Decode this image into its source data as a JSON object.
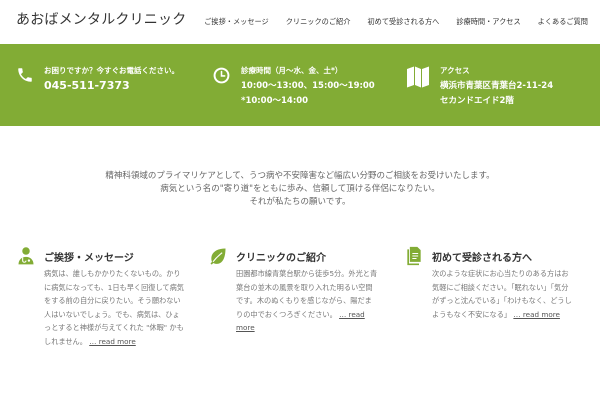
{
  "header": {
    "site_title": "あおばメンタルクリニック",
    "nav": [
      "ご挨拶・メッセージ",
      "クリニックのご紹介",
      "初めて受診される方へ",
      "診療時間・アクセス",
      "よくあるご質問"
    ]
  },
  "info": {
    "phone": {
      "label": "お困りですか？今すぐお電話ください。",
      "value": "045-511-7373",
      "icon": "phone-icon"
    },
    "hours": {
      "label": "診療時間（月〜水、金、土*）",
      "line1": "10:00〜13:00、15:00〜19:00",
      "line2": "*10:00〜14:00",
      "icon": "clock-icon"
    },
    "access": {
      "label": "アクセス",
      "line1": "横浜市青葉区青葉台2-11-24",
      "line2": "セカンドエイド2階",
      "icon": "map-icon"
    },
    "bar_color": "#82ac35"
  },
  "intro": {
    "line1": "精神科領域のプライマリケアとして、うつ病や不安障害など幅広い分野のご相談をお受けいたします。",
    "line2": "病気という名の\"寄り道\"をともに歩み、信頼して頂ける伴侶になりたい。",
    "line3": "それが私たちの願いです。"
  },
  "features": [
    {
      "title": "ご挨拶・メッセージ",
      "icon": "doctor-icon",
      "text": "病気は、誰しもかかりたくないもの。かりに病気になっても、1日も早く回復して病気をする前の自分に戻りたい。そう願わない人はいないでしょう。でも、病気は、ひょっとすると神様が与えてくれた \"休暇\" かもしれません。",
      "more": "… read more"
    },
    {
      "title": "クリニックのご紹介",
      "icon": "leaf-icon",
      "text": "田園都市線青葉台駅から徒歩5分。外光と青葉台の並木の風景を取り入れた明るい空間です。木のぬくもりを感じながら、陽だまりの中でおくつろぎください。",
      "more": "… read more"
    },
    {
      "title": "初めて受診される方へ",
      "icon": "document-icon",
      "text": "次のような症状にお心当たりのある方はお気軽にご相談ください。「眠れない」「気分がずっと沈んでいる」「わけもなく、どうしようもなく不安になる」",
      "more": "… read more"
    }
  ]
}
